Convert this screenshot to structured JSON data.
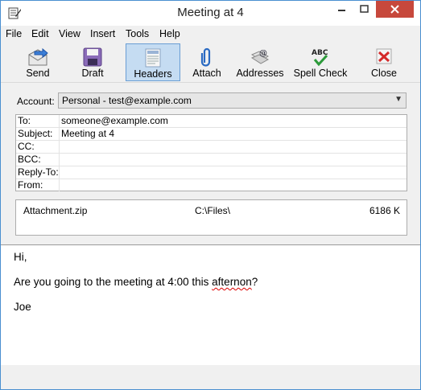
{
  "window": {
    "title": "Meeting at 4"
  },
  "menu": [
    {
      "label": "File"
    },
    {
      "label": "Edit"
    },
    {
      "label": "View"
    },
    {
      "label": "Insert"
    },
    {
      "label": "Tools"
    },
    {
      "label": "Help"
    }
  ],
  "toolbar": {
    "send": "Send",
    "draft": "Draft",
    "headers": "Headers",
    "attach": "Attach",
    "addresses": "Addresses",
    "spell_check": "Spell Check",
    "close": "Close",
    "active": "Headers"
  },
  "account": {
    "label": "Account:",
    "value": "Personal - test@example.com"
  },
  "headers": [
    {
      "key": "To:",
      "value": "someone@example.com"
    },
    {
      "key": "Subject:",
      "value": "Meeting at 4"
    },
    {
      "key": "CC:",
      "value": ""
    },
    {
      "key": "BCC:",
      "value": ""
    },
    {
      "key": "Reply-To:",
      "value": ""
    },
    {
      "key": "From:",
      "value": ""
    }
  ],
  "attachment": {
    "name": "Attachment.zip",
    "path": "C:\\Files\\",
    "size": "6186 K"
  },
  "body": {
    "line1": "Hi,",
    "line2_pre": "Are you going to the meeting at 4:00 this ",
    "line2_misspelled": "afternon",
    "line2_post": "?",
    "line3": "Joe"
  },
  "colors": {
    "accent": "#4a8fd0",
    "close_button": "#c7483c",
    "active_button": "#c5dcf2"
  }
}
